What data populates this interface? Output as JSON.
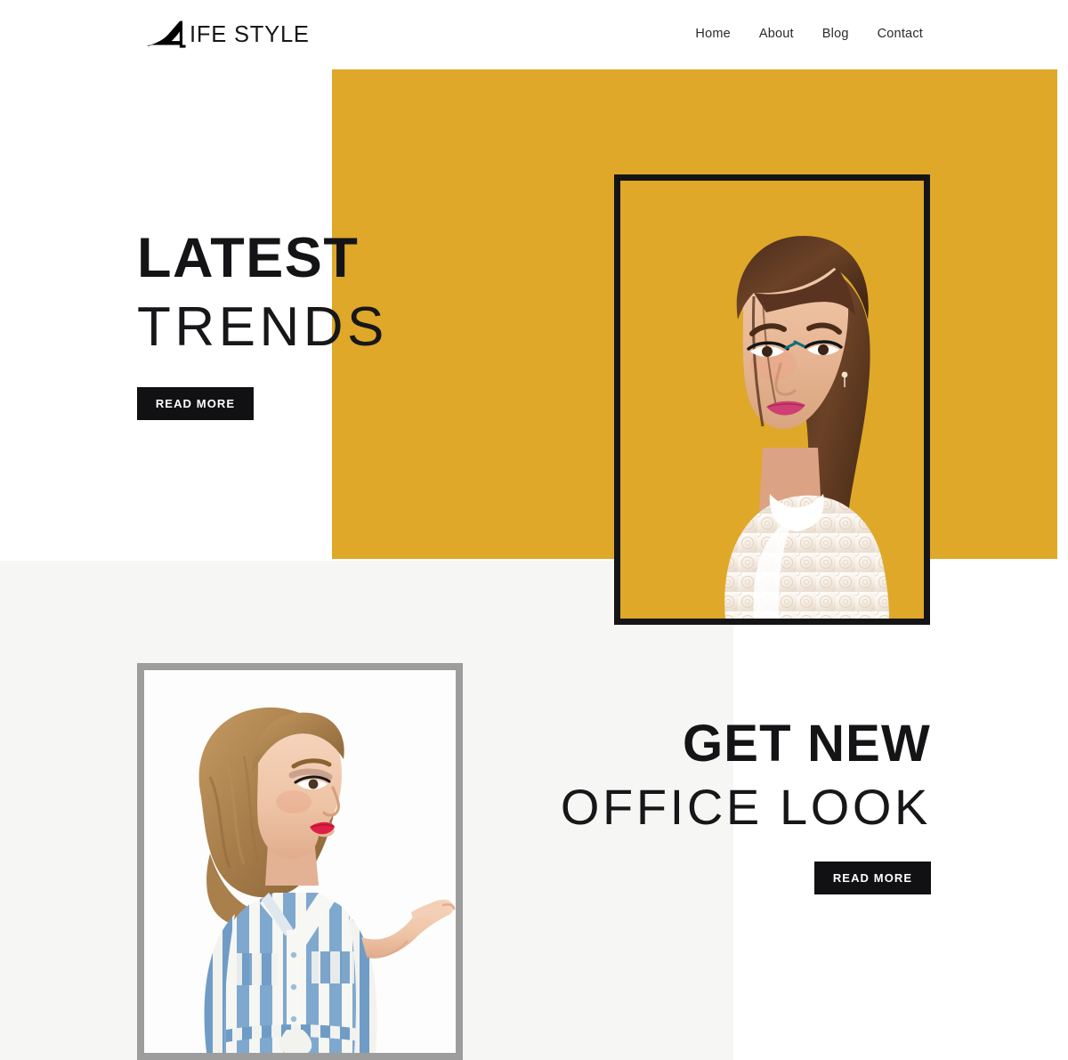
{
  "site": {
    "brand_name": "IFE STYLE",
    "brand_full": "LIFE STYLE",
    "logo_icon": "high-heel-shoe-icon",
    "accent_yellow": "#dfa829",
    "light_gray": "#f6f6f4",
    "frame_gray": "#9d9d9d",
    "ink": "#141417"
  },
  "nav": {
    "items": [
      {
        "label": "Home"
      },
      {
        "label": "About"
      },
      {
        "label": "Blog"
      },
      {
        "label": "Contact"
      }
    ]
  },
  "hero": {
    "headline_bold": "LATEST",
    "headline_light": "TRENDS",
    "cta_label": "READ MORE",
    "image_alt": "Woman with dark brown hair in white lace blouse on yellow background"
  },
  "section2": {
    "headline_bold": "GET NEW",
    "headline_light": "OFFICE LOOK",
    "cta_label": "READ MORE",
    "image_alt": "Blonde woman in blue and white striped shirt dress with open palm gesture"
  }
}
